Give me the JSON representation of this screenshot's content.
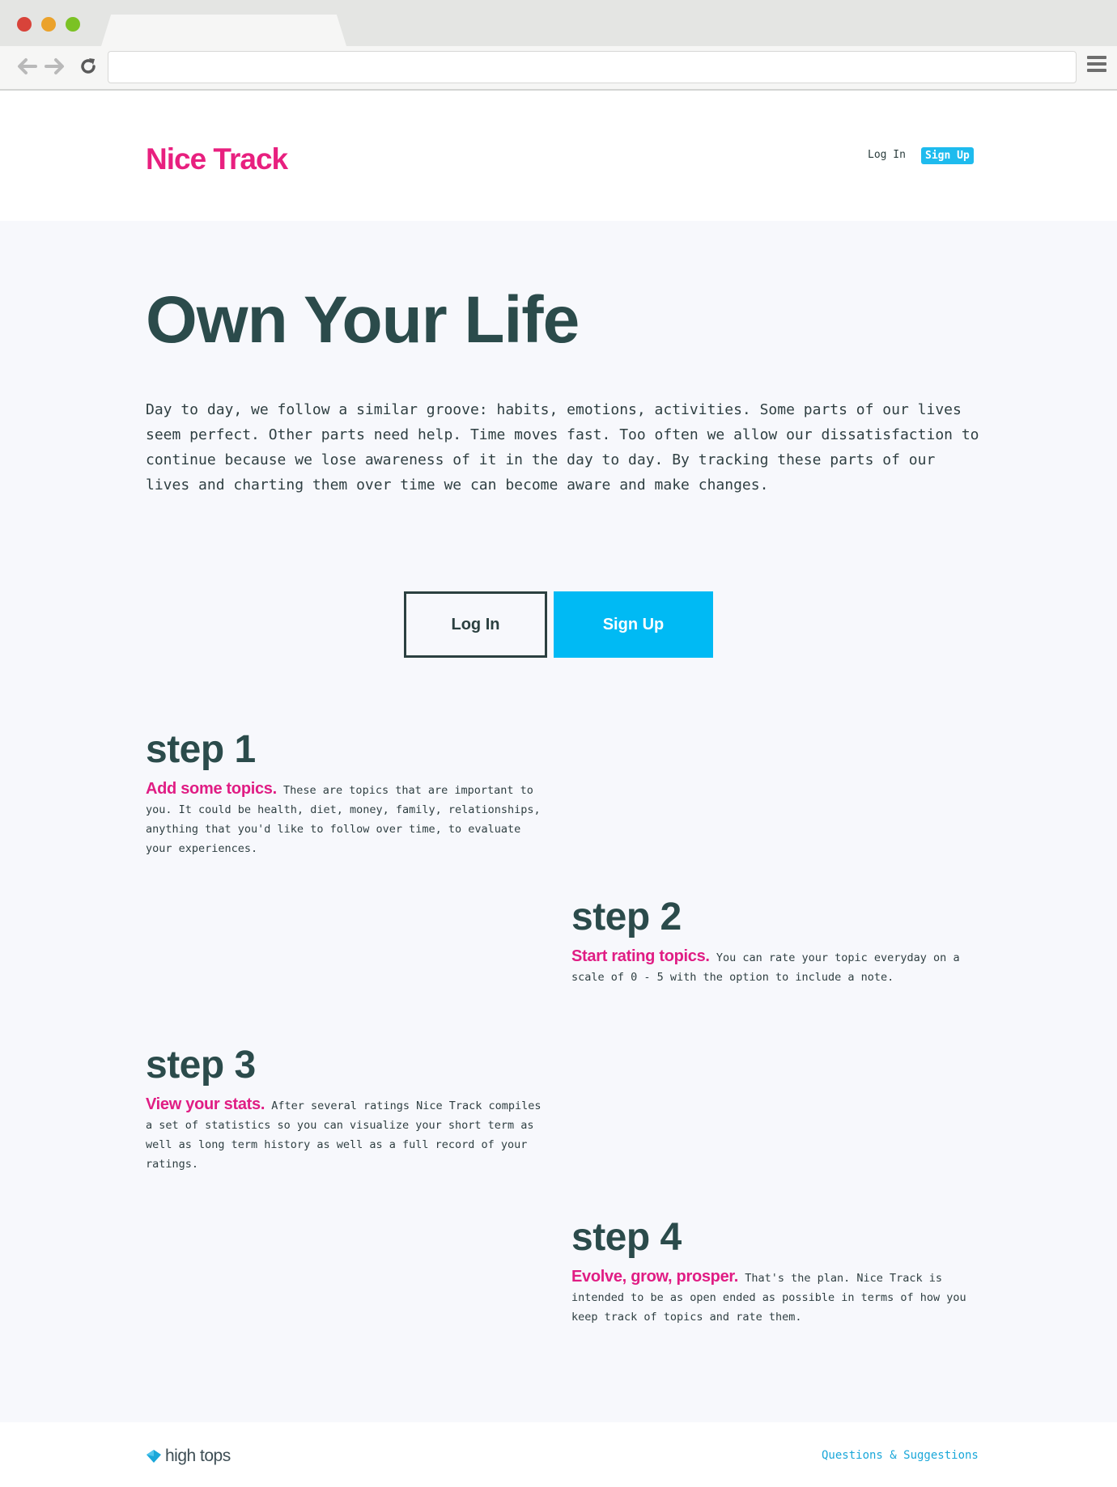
{
  "browser": {
    "url": "",
    "icons": {
      "back": "arrow-left-icon",
      "forward": "arrow-right-icon",
      "reload": "reload-icon",
      "menu": "hamburger-menu-icon"
    },
    "traffic_light_colors": {
      "close": "#d8433a",
      "minimize": "#eba22b",
      "zoom": "#7bc224"
    }
  },
  "header": {
    "logo": "Nice Track",
    "login_label": "Log In",
    "signup_label": "Sign Up"
  },
  "hero": {
    "title": "Own Your Life",
    "intro": "Day to day, we follow a similar groove: habits, emotions, activities. Some parts of our lives seem perfect. Other parts need help. Time moves fast. Too often we allow our dissatisfaction to continue because we lose awareness of it in the day to day. By tracking these parts of our lives and charting them over time we can become aware and make changes.",
    "login_label": "Log In",
    "signup_label": "Sign Up"
  },
  "steps": [
    {
      "title": "step 1",
      "lead": "Add some topics.",
      "text": "These are topics that are important to you. It could be health, diet, money, family, relationships, anything that you'd like to follow over time, to evaluate your experiences."
    },
    {
      "title": "step 2",
      "lead": "Start rating topics.",
      "text": "You can rate your topic everyday on a scale of 0 - 5 with the option to include a note."
    },
    {
      "title": "step 3",
      "lead": "View your stats.",
      "text": "After several ratings Nice Track compiles a set of statistics so you can visualize your short term as well as long term history as well as a full record of your ratings."
    },
    {
      "title": "step 4",
      "lead": "Evolve, grow, prosper.",
      "text": "That's the plan. Nice Track is intended to be as open ended as possible in terms of how you keep track of topics and rate them."
    }
  ],
  "footer": {
    "brand": "high tops",
    "brand_icon": "diamond-icon",
    "link": "Questions & Suggestions"
  },
  "colors": {
    "brand_pink": "#e8207f",
    "accent_blue": "#00baf4",
    "heading_dark": "#2b4b4b",
    "background": "#f7f8fc"
  }
}
